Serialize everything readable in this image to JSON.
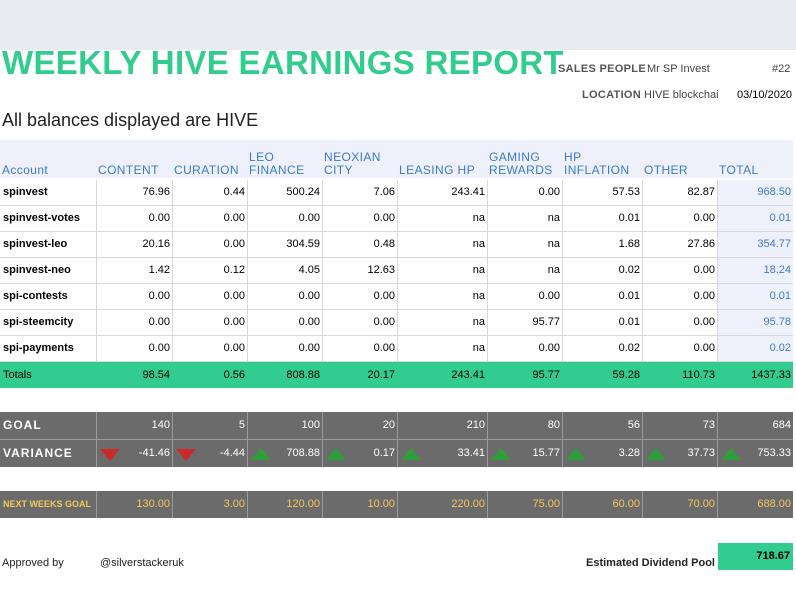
{
  "report": {
    "title": "WEEKLY HIVE EARNINGS REPORT",
    "sales_people_label": "SALES PEOPLE",
    "sales_people_value": "Mr SP Invest",
    "number": "#22",
    "location_label": "LOCATION",
    "location_value": "HIVE blockchai",
    "date": "03/10/2020",
    "subtitle": "All balances displayed are HIVE"
  },
  "columns": [
    {
      "l1": "",
      "l2": "Account"
    },
    {
      "l1": "",
      "l2": "CONTENT"
    },
    {
      "l1": "",
      "l2": "CURATION"
    },
    {
      "l1": "LEO",
      "l2": "FINANCE"
    },
    {
      "l1": "NEOXIAN",
      "l2": "CITY"
    },
    {
      "l1": "",
      "l2": "LEASING HP"
    },
    {
      "l1": "GAMING",
      "l2": "REWARDS"
    },
    {
      "l1": "HP",
      "l2": "INFLATION"
    },
    {
      "l1": "",
      "l2": "OTHER"
    },
    {
      "l1": "",
      "l2": "TOTAL"
    }
  ],
  "rows": [
    [
      "spinvest",
      "76.96",
      "0.44",
      "500.24",
      "7.06",
      "243.41",
      "0.00",
      "57.53",
      "82.87",
      "968.50"
    ],
    [
      "spinvest-votes",
      "0.00",
      "0.00",
      "0.00",
      "0.00",
      "na",
      "na",
      "0.01",
      "0.00",
      "0.01"
    ],
    [
      "spinvest-leo",
      "20.16",
      "0.00",
      "304.59",
      "0.48",
      "na",
      "na",
      "1.68",
      "27.86",
      "354.77"
    ],
    [
      "spinvest-neo",
      "1.42",
      "0.12",
      "4.05",
      "12.63",
      "na",
      "na",
      "0.02",
      "0.00",
      "18.24"
    ],
    [
      "spi-contests",
      "0.00",
      "0.00",
      "0.00",
      "0.00",
      "na",
      "0.00",
      "0.01",
      "0.00",
      "0.01"
    ],
    [
      "spi-steemcity",
      "0.00",
      "0.00",
      "0.00",
      "0.00",
      "na",
      "95.77",
      "0.01",
      "0.00",
      "95.78"
    ],
    [
      "spi-payments",
      "0.00",
      "0.00",
      "0.00",
      "0.00",
      "na",
      "0.00",
      "0.02",
      "0.00",
      "0.02"
    ]
  ],
  "totals": [
    "Totals",
    "98.54",
    "0.56",
    "808.88",
    "20.17",
    "243.41",
    "95.77",
    "59.28",
    "110.73",
    "1437.33"
  ],
  "goal": {
    "label": "GOAL",
    "values": [
      "140",
      "5",
      "100",
      "20",
      "210",
      "80",
      "56",
      "73",
      "684"
    ]
  },
  "variance": {
    "label": "VARIANCE",
    "values": [
      "-41.46",
      "-4.44",
      "708.88",
      "0.17",
      "33.41",
      "15.77",
      "3.28",
      "37.73",
      "753.33"
    ],
    "icons": [
      "arrow-down-icon",
      "arrow-down-icon",
      "arrow-up-icon",
      "arrow-up-icon",
      "arrow-up-icon",
      "arrow-up-icon",
      "arrow-up-icon",
      "arrow-up-icon",
      "arrow-up-icon"
    ]
  },
  "next_goal": {
    "label": "NEXT WEEKS GOAL",
    "values": [
      "130.00",
      "3.00",
      "120.00",
      "10.00",
      "220.00",
      "75.00",
      "60.00",
      "70.00",
      "688.00"
    ]
  },
  "footer": {
    "approved_label": "Approved by",
    "approved_value": "@silverstackeruk",
    "pool_label": "Estimated Dividend Pool",
    "pool_value": "718.67"
  },
  "colors": {
    "accent_green": "#33cc8f",
    "header_blue": "#3a7bc8",
    "goal_grey": "#6b6b6b",
    "next_goal_text": "#f4c65e"
  }
}
